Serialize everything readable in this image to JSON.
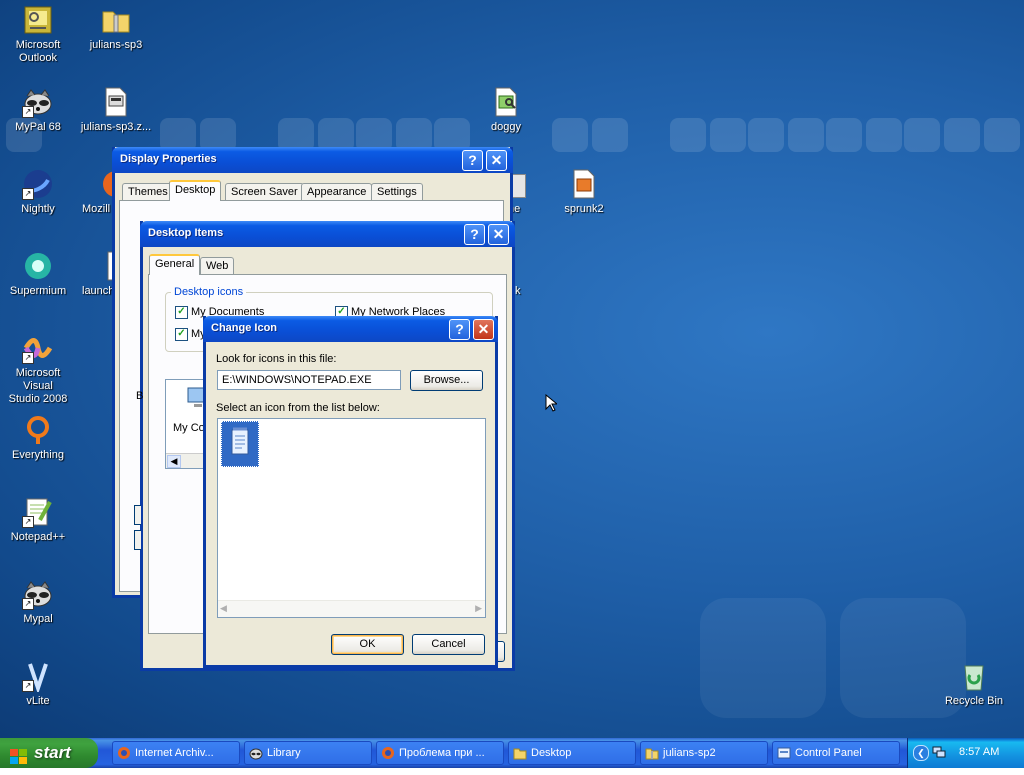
{
  "desktop": {
    "icons": [
      {
        "id": "outlook",
        "label": "Microsoft\nOutlook"
      },
      {
        "id": "julians-sp3",
        "label": "julians-sp3"
      },
      {
        "id": "mypal68",
        "label": "MyPal 68"
      },
      {
        "id": "julians-sp3-zip",
        "label": "julians-sp3.z..."
      },
      {
        "id": "doggy",
        "label": "doggy"
      },
      {
        "id": "nightly",
        "label": "Nightly"
      },
      {
        "id": "mozilla",
        "label": "Mozill"
      },
      {
        "id": "sprunk2",
        "label": "sprunk2"
      },
      {
        "id": "supermium",
        "label": "Supermium"
      },
      {
        "id": "launch",
        "label": "launch"
      },
      {
        "id": "msvs2008",
        "label": "Microsoft Visual\nStudio 2008"
      },
      {
        "id": "everything",
        "label": "Everything"
      },
      {
        "id": "notepadpp",
        "label": "Notepad++"
      },
      {
        "id": "mypal",
        "label": "Mypal"
      },
      {
        "id": "vlite",
        "label": "vLite"
      },
      {
        "id": "recycle-bin",
        "label": "Recycle Bin"
      }
    ],
    "partial_labels": {
      "behind_right_1": "ne",
      "behind_right_2": "k"
    }
  },
  "display_properties": {
    "title": "Display Properties",
    "tabs": [
      "Themes",
      "Desktop",
      "Screen Saver",
      "Appearance",
      "Settings"
    ],
    "active_tab": "Desktop"
  },
  "desktop_items": {
    "title": "Desktop Items",
    "tabs": [
      "General",
      "Web"
    ],
    "group_label": "Desktop icons",
    "checkboxes": [
      {
        "label": "My Documents",
        "checked": true
      },
      {
        "label": "My Network Places",
        "checked": true
      },
      {
        "label": "My",
        "checked": true
      }
    ],
    "partial_icon_label": "My Co",
    "side_letter": "B"
  },
  "change_icon": {
    "title": "Change Icon",
    "look_label": "Look for icons in this file:",
    "file_path": "E:\\WINDOWS\\NOTEPAD.EXE",
    "browse_label": "Browse...",
    "select_label": "Select an icon from the list below:",
    "ok_label": "OK",
    "cancel_label": "Cancel",
    "icons": [
      {
        "name": "notepad-icon",
        "selected": true
      }
    ]
  },
  "taskbar": {
    "start_label": "start",
    "buttons": [
      {
        "label": "Internet Archiv...",
        "icon": "firefox-icon"
      },
      {
        "label": "Library",
        "icon": "mypal-icon"
      },
      {
        "label": "Проблема при ...",
        "icon": "firefox-icon"
      },
      {
        "label": "Desktop",
        "icon": "folder-icon"
      },
      {
        "label": "julians-sp2",
        "icon": "zip-folder-icon"
      },
      {
        "label": "Control Panel",
        "icon": "control-panel-icon"
      }
    ],
    "clock": "8:57 AM"
  },
  "colors": {
    "title_blue": "#0a4fd6",
    "start_green": "#3fa23f",
    "close_red": "#c2351a",
    "desktop_blue": "#1f5fa8"
  }
}
